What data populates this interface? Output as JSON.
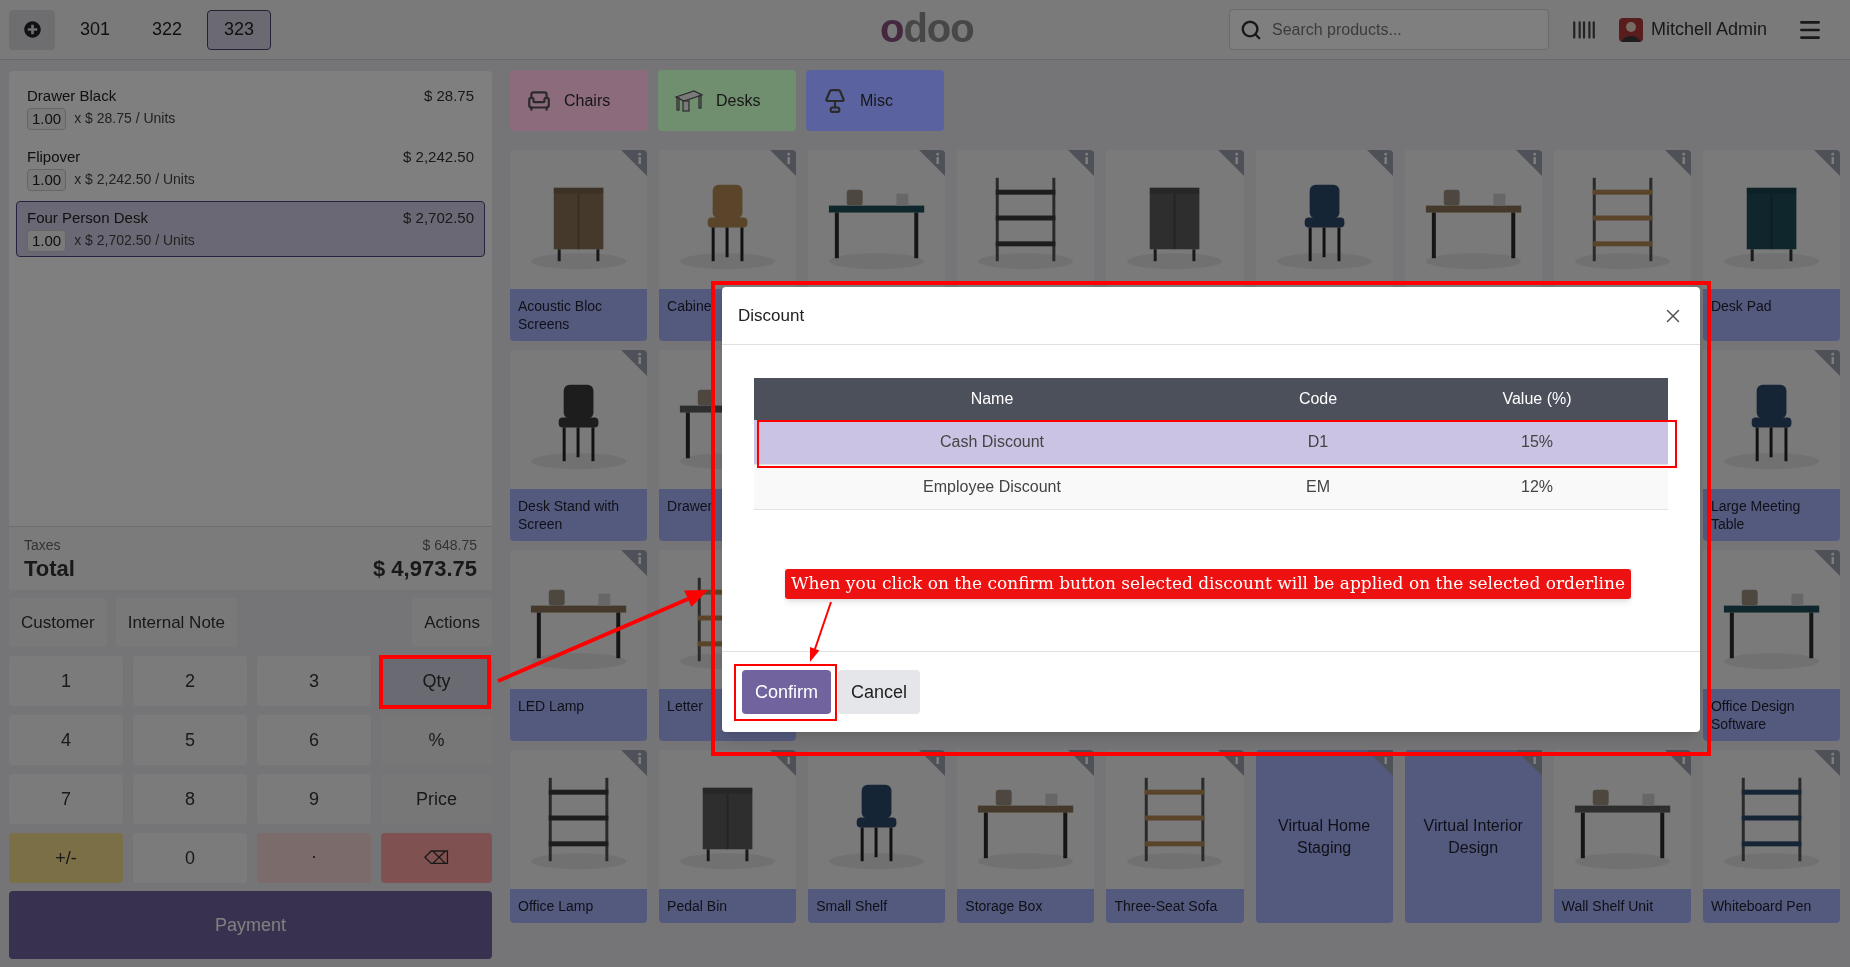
{
  "top_bar": {
    "orders": [
      {
        "label": "301",
        "selected": false
      },
      {
        "label": "322",
        "selected": false
      },
      {
        "label": "323",
        "selected": true
      }
    ],
    "logo": "odoo",
    "search": {
      "placeholder": "Search products..."
    },
    "user": "Mitchell Admin"
  },
  "order_lines": [
    {
      "product": "Drawer Black",
      "price": "$ 28.75",
      "quantity": "1.00",
      "unit_price": "x $ 28.75 / Units",
      "selected": false
    },
    {
      "product": "Flipover",
      "price": "$ 2,242.50",
      "quantity": "1.00",
      "unit_price": "x $ 2,242.50 / Units",
      "selected": false
    },
    {
      "product": "Four Person Desk",
      "price": "$ 2,702.50",
      "quantity": "1.00",
      "unit_price": "x $ 2,702.50 / Units",
      "selected": true
    }
  ],
  "totals": {
    "taxes_label": "Taxes",
    "taxes": "$ 648.75",
    "total_label": "Total",
    "total": "$ 4,973.75"
  },
  "control_buttons": [
    "Customer",
    "Internal Note",
    "Actions"
  ],
  "numpad": [
    {
      "label": "1",
      "kind": "digit"
    },
    {
      "label": "2",
      "kind": "digit"
    },
    {
      "label": "3",
      "kind": "digit"
    },
    {
      "label": "Qty",
      "kind": "mode",
      "selected": true
    },
    {
      "label": "4",
      "kind": "digit"
    },
    {
      "label": "5",
      "kind": "digit"
    },
    {
      "label": "6",
      "kind": "digit"
    },
    {
      "label": "%",
      "kind": "mode",
      "selected": false
    },
    {
      "label": "7",
      "kind": "digit"
    },
    {
      "label": "8",
      "kind": "digit"
    },
    {
      "label": "9",
      "kind": "digit"
    },
    {
      "label": "Price",
      "kind": "mode",
      "selected": false
    },
    {
      "label": "+/-",
      "kind": "sign"
    },
    {
      "label": "0",
      "kind": "digit"
    },
    {
      "label": ".",
      "kind": "dot"
    },
    {
      "label": "⌫",
      "kind": "backspace"
    }
  ],
  "payment_button": "Payment",
  "categories": [
    {
      "label": "Chairs",
      "kind": "chair",
      "color": "#8c6b7c"
    },
    {
      "label": "Desks",
      "kind": "desk",
      "color": "#6f8f6f"
    },
    {
      "label": "Misc",
      "kind": "misc",
      "color": "#5a63a0"
    }
  ],
  "products": [
    {
      "kind": "picture",
      "name": "Acoustic Bloc Screens"
    },
    {
      "kind": "picture",
      "name": "Cabine"
    },
    {
      "kind": "picture"
    },
    {
      "kind": "picture"
    },
    {
      "kind": "picture"
    },
    {
      "kind": "picture"
    },
    {
      "kind": "picture"
    },
    {
      "kind": "picture"
    },
    {
      "kind": "picture",
      "name": "Desk Pad"
    },
    {
      "kind": "picture",
      "name": "Desk Stand with Screen"
    },
    {
      "kind": "partial",
      "name": "Drawer"
    },
    {
      "kind": "covered"
    },
    {
      "kind": "covered"
    },
    {
      "kind": "covered"
    },
    {
      "kind": "covered"
    },
    {
      "kind": "covered"
    },
    {
      "kind": "covered"
    },
    {
      "kind": "picture",
      "name": "Large Meeting Table"
    },
    {
      "kind": "picture",
      "name": "LED Lamp"
    },
    {
      "kind": "partial",
      "name": "Letter"
    },
    {
      "kind": "covered"
    },
    {
      "kind": "covered"
    },
    {
      "kind": "covered"
    },
    {
      "kind": "covered"
    },
    {
      "kind": "covered"
    },
    {
      "kind": "covered"
    },
    {
      "kind": "picture",
      "name": "Office Design Software"
    },
    {
      "kind": "picture",
      "name": "Office Lamp"
    },
    {
      "kind": "picture",
      "name": "Pedal Bin"
    },
    {
      "kind": "picture",
      "name": "Small Shelf"
    },
    {
      "kind": "picture",
      "name": "Storage Box"
    },
    {
      "kind": "picture",
      "name": "Three-Seat Sofa"
    },
    {
      "kind": "text",
      "name": "Virtual Home Staging"
    },
    {
      "kind": "text",
      "name": "Virtual Interior Design"
    },
    {
      "kind": "picture",
      "name": "Wall Shelf Unit"
    },
    {
      "kind": "picture",
      "name": "Whiteboard Pen"
    }
  ],
  "dialog": {
    "title": "Discount",
    "columns": [
      "Name",
      "Code",
      "Value (%)"
    ],
    "rows": [
      {
        "name": "Cash Discount",
        "code": "D1",
        "value": "15%",
        "selected": true
      },
      {
        "name": "Employee Discount",
        "code": "EM",
        "value": "12%",
        "selected": false
      }
    ],
    "buttons": [
      {
        "label": "Confirm",
        "kind": "primary"
      },
      {
        "label": "Cancel",
        "kind": "secondary"
      }
    ]
  },
  "annotation": {
    "text": "When you click on the confirm button selected discount will be applied on the selected orderline"
  }
}
